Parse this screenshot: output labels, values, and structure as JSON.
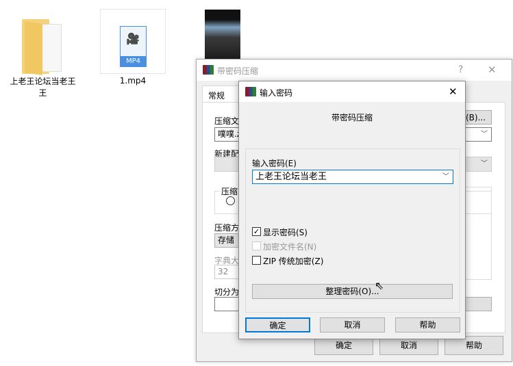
{
  "desktop": {
    "items": [
      {
        "label": "上老王论坛当老王",
        "line2": "王",
        "icon": "folder-icon"
      },
      {
        "label": "1.mp4",
        "badge": "MP4",
        "icon": "video-file-icon"
      }
    ]
  },
  "back_dialog": {
    "title": "带密码压缩",
    "help": "?",
    "close": "✕",
    "tab": "常规",
    "archive_label": "压缩文",
    "archive_value": "噗噗.z",
    "browse": "(B)...",
    "profile_label": "新建配",
    "group_label": "压缩",
    "method_label": "压缩方",
    "method_value": "存储",
    "dict_label": "字典大",
    "dict_value": "32",
    "split_label": "切分为",
    "ok": "确定",
    "cancel": "取消",
    "help_btn": "帮助"
  },
  "front_dialog": {
    "title": "输入密码",
    "close": "✕",
    "heading": "带密码压缩",
    "password_label": "输入密码(E)",
    "password_value": "上老王论坛当老王",
    "show_password": {
      "label": "显示密码(S)",
      "checked": true
    },
    "encrypt_names": {
      "label": "加密文件名(N)",
      "checked": false,
      "disabled": true
    },
    "zip_legacy": {
      "label": "ZIP 传统加密(Z)",
      "checked": false
    },
    "organize": "整理密码(O)...",
    "ok": "确定",
    "cancel": "取消",
    "help": "帮助"
  },
  "colors": {
    "accent": "#0078d7",
    "dialog_bg": "#f0f0f0",
    "mp4_badge": "#4a90e2"
  }
}
